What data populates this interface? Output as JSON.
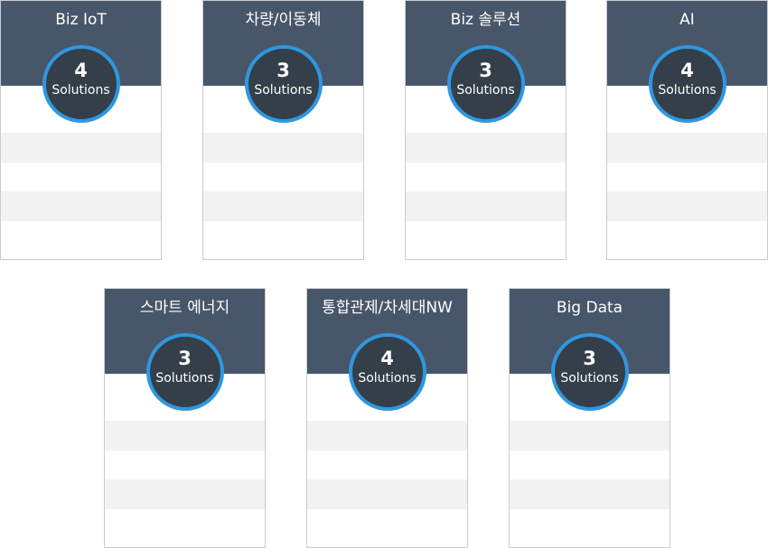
{
  "categories": [
    {
      "title": "Biz IoT",
      "count": "4",
      "unit": "Solutions"
    },
    {
      "title": "차량/이동체",
      "count": "3",
      "unit": "Solutions"
    },
    {
      "title": "Biz 솔루션",
      "count": "3",
      "unit": "Solutions"
    },
    {
      "title": "AI",
      "count": "4",
      "unit": "Solutions"
    },
    {
      "title": "스마트 에너지",
      "count": "3",
      "unit": "Solutions"
    },
    {
      "title": "통합관제/차세대NW",
      "count": "4",
      "unit": "Solutions"
    },
    {
      "title": "Big Data",
      "count": "3",
      "unit": "Solutions"
    }
  ],
  "colors": {
    "header": "#48566a",
    "badge_fill": "#343f49",
    "badge_ring": "#2f97e0",
    "stripe": "#f2f2f2",
    "border": "#c9cdd2"
  }
}
